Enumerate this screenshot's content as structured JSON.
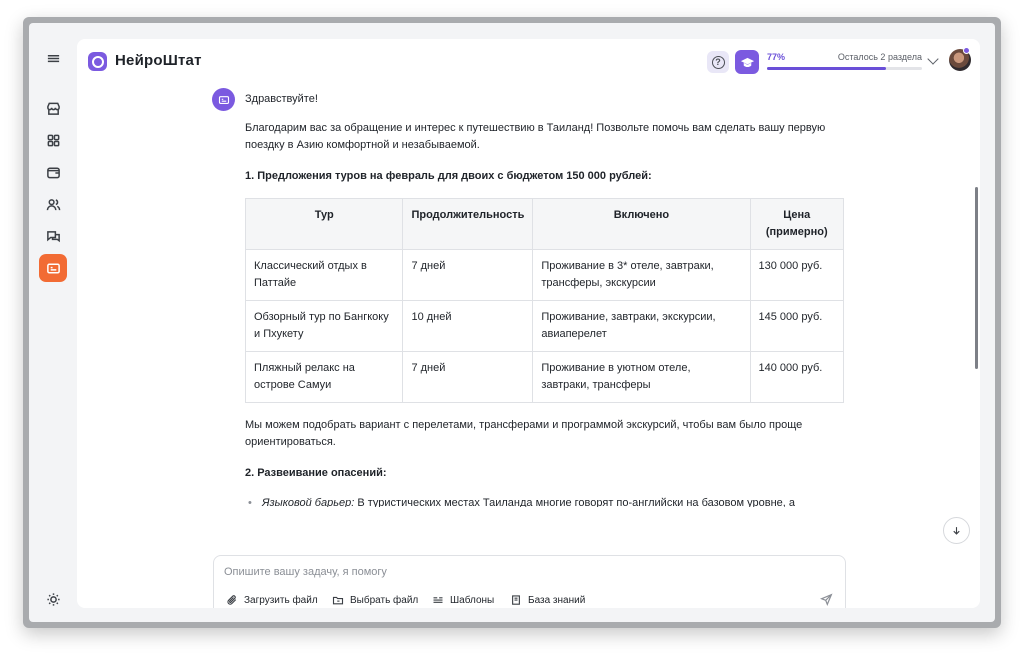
{
  "app": {
    "brand": "НейроШтат",
    "accent": "#7b5ae0",
    "active_nav": "#f26b34"
  },
  "sidebar": {
    "items": [
      {
        "icon": "menu-icon"
      },
      {
        "icon": "store-icon"
      },
      {
        "icon": "grid-icon"
      },
      {
        "icon": "wallet-icon"
      },
      {
        "icon": "users-icon"
      },
      {
        "icon": "chat-icon"
      },
      {
        "icon": "card-icon",
        "active": true
      },
      {
        "icon": "sun-icon"
      }
    ]
  },
  "header": {
    "help_label": "?",
    "progress": {
      "percent_label": "77%",
      "value": 0.77,
      "remaining": "Осталось 2 раздела"
    }
  },
  "message": {
    "greeting": "Здравствуйте!",
    "intro": "Благодарим вас за обращение и интерес к путешествию в Таиланд! Позвольте помочь вам сделать вашу первую поездку в Азию комфортной и незабываемой.",
    "section1": "1. Предложения туров на февраль для двоих с бюджетом 150 000 рублей:",
    "table": {
      "headers": [
        "Тур",
        "Продолжительность",
        "Включено",
        "Цена (примерно)"
      ],
      "rows": [
        [
          "Классический отдых в Паттайе",
          "7 дней",
          "Проживание в 3* отеле, завтраки, трансферы, экскурсии",
          "130 000 руб."
        ],
        [
          "Обзорный тур по Бангкоку и Пхукету",
          "10 дней",
          "Проживание, завтраки, экскурсии, авиаперелет",
          "145 000 руб."
        ],
        [
          "Пляжный релакс на острове Самуи",
          "7 дней",
          "Проживание в уютном отеле, завтраки, трансферы",
          "140 000 руб."
        ]
      ]
    },
    "after_table": "Мы можем подобрать вариант с перелетами, трансферами и программой экскурсий, чтобы вам было проще ориентироваться.",
    "section2": "2. Развеивание опасений:",
    "bullet1_label": "Языковой барьер:",
    "bullet1_text": " В туристических местах Таиланда многие говорят по-английски на базовом уровне, а персонал отелей и ресторанов обычно хорошо понимает запросы гостей. Для дополнительного удобства рекомендуем скачать приложения-переводчики на телефон и взять с собой основные фразы на тайском — это вызовет симпатию"
  },
  "composer": {
    "placeholder": "Опишите вашу задачу, я помогу",
    "value": "",
    "upload_label": "Загрузить файл",
    "select_label": "Выбрать файл",
    "templates_label": "Шаблоны",
    "knowledge_label": "База знаний"
  }
}
